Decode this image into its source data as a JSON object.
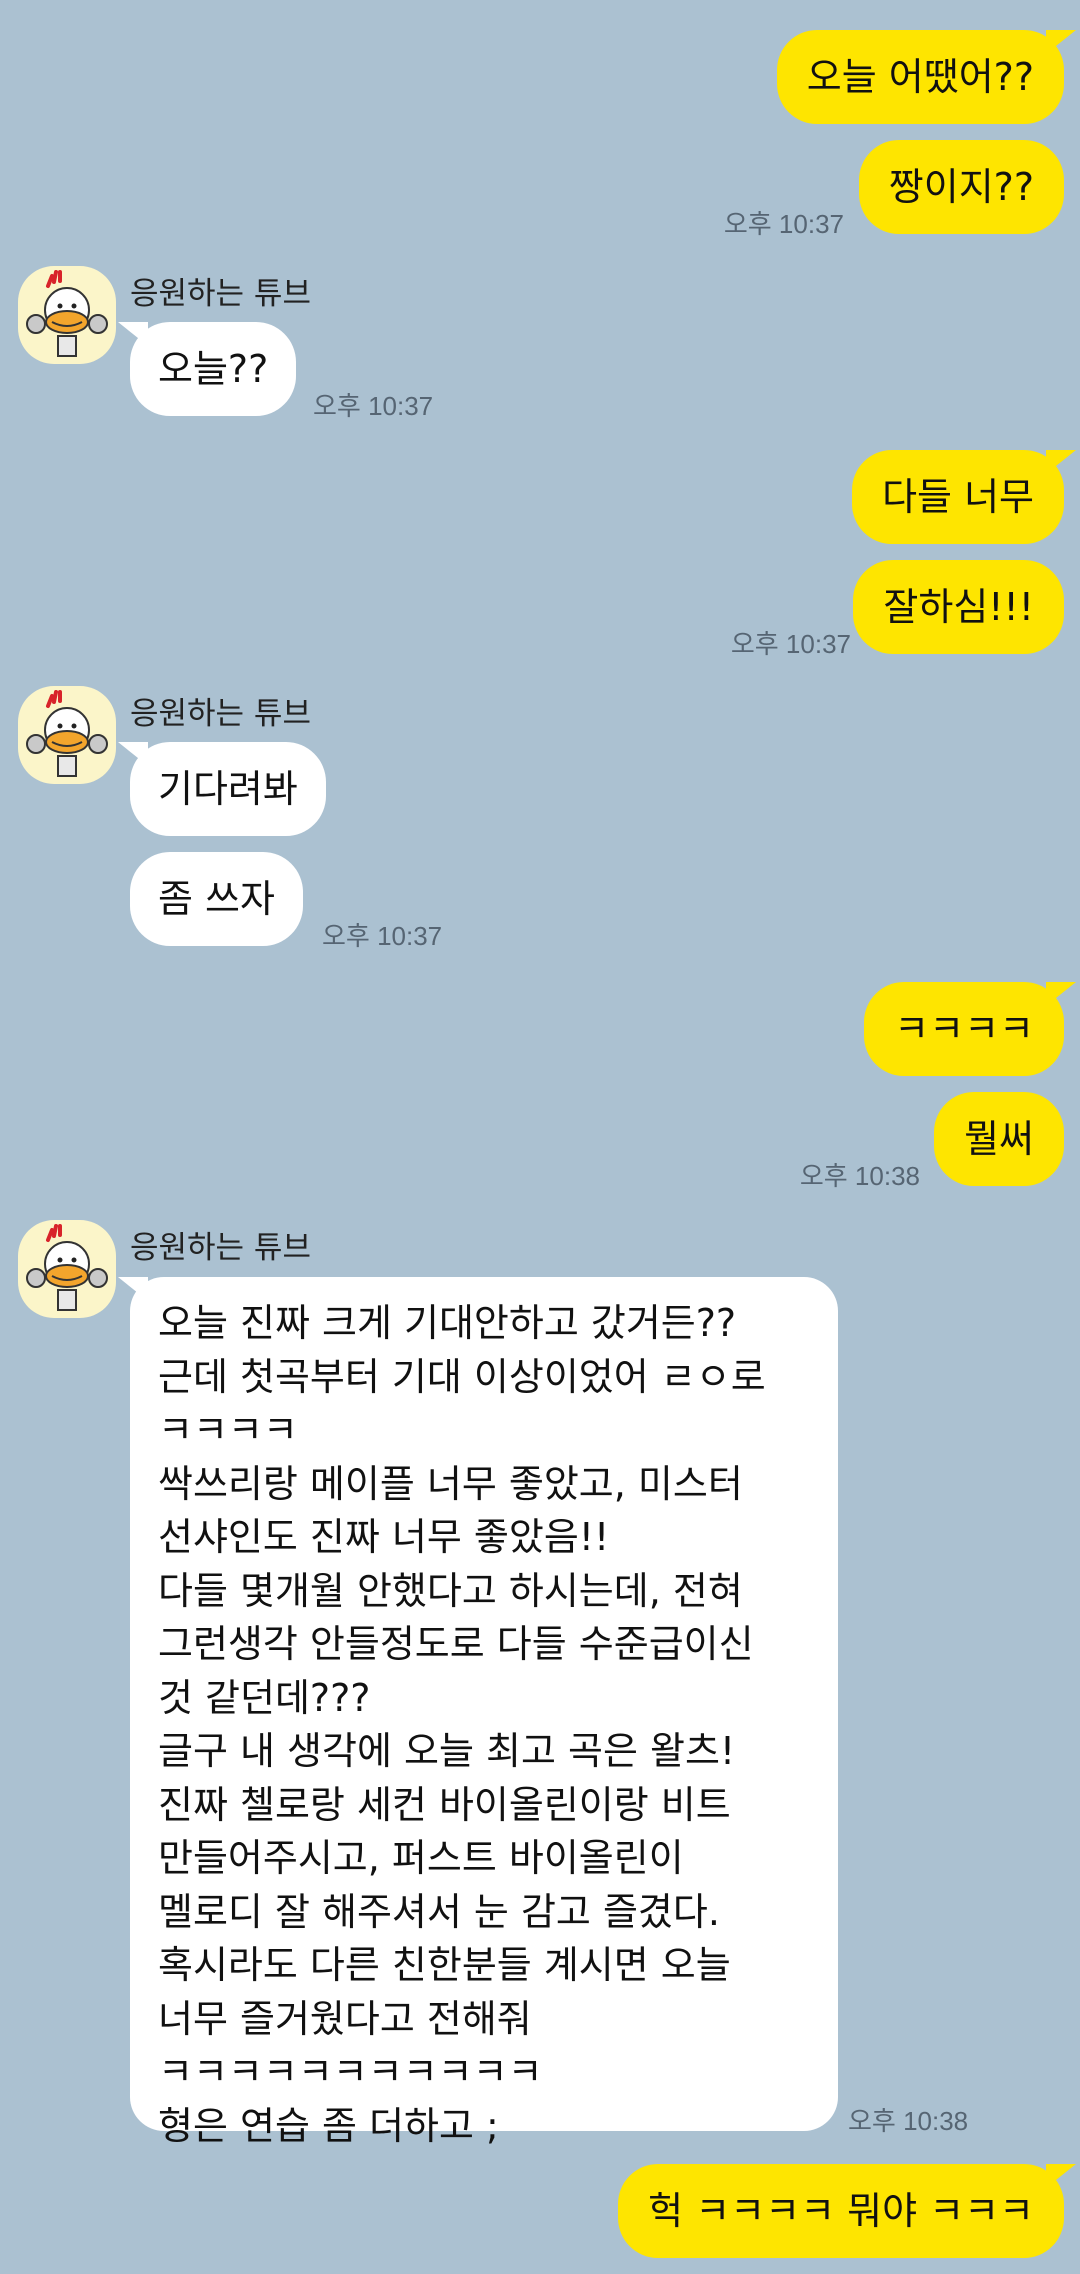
{
  "colors": {
    "background": "#abc1d1",
    "my_bubble": "#fee500",
    "other_bubble": "#ffffff",
    "timestamp": "#566573"
  },
  "contact": {
    "name": "응원하는 튜브",
    "avatar_icon": "tube-character-icon"
  },
  "messages": {
    "m1": "오늘 어땠어??",
    "m2": "짱이지??",
    "t1": "오후 10:37",
    "r1": "오늘??",
    "t2": "오후 10:37",
    "m3": "다들 너무",
    "m4": "잘하심!!!",
    "t3": "오후 10:37",
    "r2": "기다려봐",
    "r3": "좀 쓰자",
    "t4": "오후 10:37",
    "m5": "ㅋㅋㅋㅋ",
    "m6": "뭘써",
    "t5": "오후 10:38",
    "long_lines": [
      "오늘 진짜 크게 기대안하고 갔거든??",
      "근데 첫곡부터 기대 이상이었어 ㄹㅇ로",
      "ㅋㅋㅋㅋ",
      "싹쓰리랑 메이플 너무 좋았고, 미스터",
      "선샤인도 진짜 너무 좋았음!!",
      "다들 몇개월 안했다고 하시는데, 전혀",
      "그런생각 안들정도로 다들 수준급이신",
      "것 같던데???",
      "글구 내 생각에 오늘 최고 곡은 왈츠!",
      "진짜 첼로랑 세컨 바이올린이랑 비트",
      "만들어주시고, 퍼스트 바이올린이",
      "멜로디 잘 해주셔서 눈 감고 즐겼다.",
      "혹시라도 다른 친한분들 계시면 오늘",
      "너무 즐거웠다고 전해줘",
      "ㅋㅋㅋㅋㅋㅋㅋㅋㅋㅋㅋ",
      "형은 연습 좀 더하고 ;"
    ],
    "t6": "오후 10:38",
    "m7": "헉 ㅋㅋㅋㅋ 뭐야 ㅋㅋㅋ"
  }
}
